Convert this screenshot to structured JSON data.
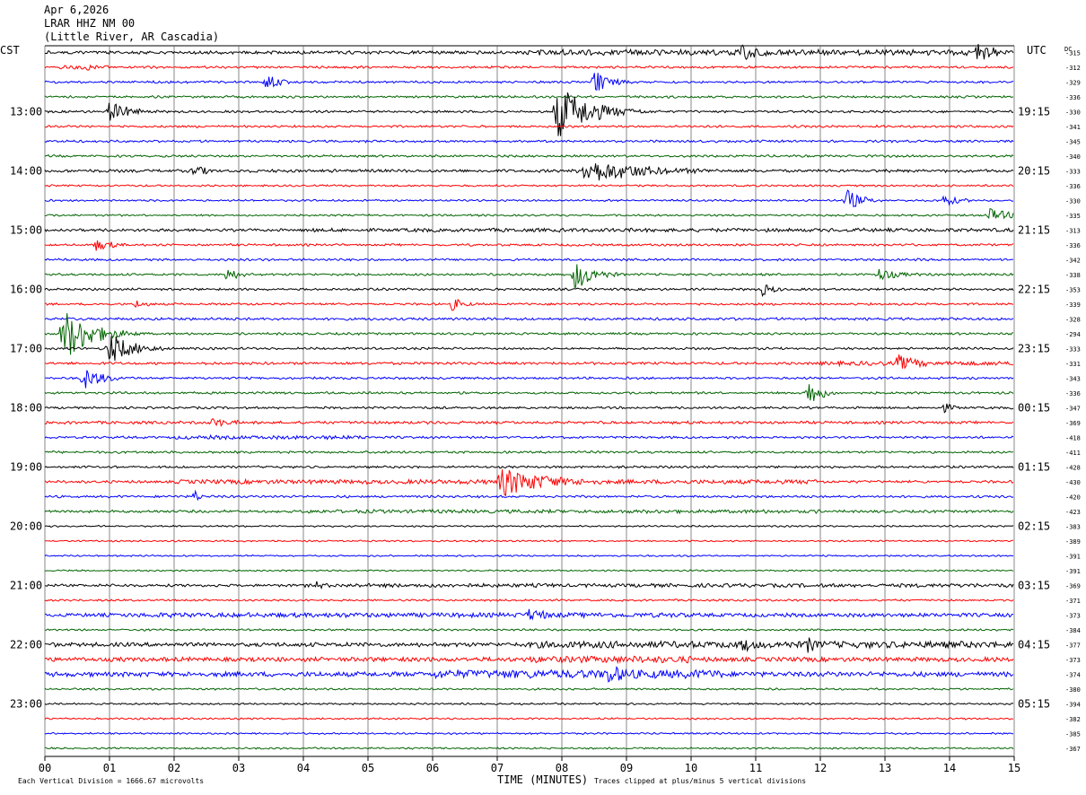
{
  "header": {
    "date": "Apr 6,2026",
    "station": "LRAR HHZ NM 00",
    "location": "(Little River, AR Cascadia)"
  },
  "footer": {
    "x_axis_title": "TIME (MINUTES)",
    "vertical_division": "Each Vertical Division = 1666.67 microvolts",
    "clip_note": "Traces clipped at plus/minus 5 vertical divisions"
  },
  "chart_data": {
    "type": "line",
    "title": "LRAR HHZ NM 00",
    "left_axis_label": "CST",
    "right_axis_label": "UTC",
    "dc_label": "DC",
    "xlabel": "TIME (MINUTES)",
    "xlim": [
      0,
      15
    ],
    "x_ticks": [
      "00",
      "01",
      "02",
      "03",
      "04",
      "05",
      "06",
      "07",
      "08",
      "09",
      "10",
      "11",
      "12",
      "13",
      "14",
      "15"
    ],
    "trace_colors": [
      "#000000",
      "#ff0000",
      "#0000ff",
      "#006400"
    ],
    "cst_hour_labels": [
      "13:00",
      "14:00",
      "15:00",
      "16:00",
      "17:00",
      "18:00",
      "19:00",
      "20:00",
      "21:00",
      "22:00",
      "23:00"
    ],
    "utc_hour_labels": [
      "19:15",
      "20:15",
      "21:15",
      "22:15",
      "23:15",
      "00:15",
      "01:15",
      "02:15",
      "03:15",
      "04:15",
      "05:15"
    ],
    "hour_label_first_row": 4,
    "hour_label_every_rows": 4,
    "dc_offsets": [
      -315,
      -312,
      -329,
      -336,
      -330,
      -341,
      -345,
      -340,
      -333,
      -336,
      -330,
      -335,
      -313,
      -336,
      -342,
      -338,
      -353,
      -339,
      -328,
      -294,
      -333,
      -331,
      -343,
      -336,
      -347,
      -369,
      -418,
      -411,
      -428,
      -430,
      -420,
      -423,
      -383,
      -389,
      -391,
      -391,
      -369,
      -371,
      -373,
      -384,
      -377,
      -373,
      -374,
      -380,
      -394,
      -382,
      -385,
      -367
    ],
    "row_noise_level": [
      1.5,
      1,
      1,
      1,
      1,
      1,
      1,
      1,
      1.4,
      0.8,
      0.8,
      0.8,
      1.3,
      1,
      1,
      1,
      1,
      1,
      1.2,
      1,
      1,
      1.2,
      1,
      1,
      1,
      1.3,
      1,
      1,
      1,
      1.2,
      1,
      1.2,
      0.6,
      0.6,
      0.6,
      0.6,
      1.2,
      0.8,
      1.8,
      0.8,
      2,
      2.2,
      2.4,
      0.8,
      0.7,
      0.7,
      0.7,
      0.7
    ],
    "row_noise_bursts": [
      {
        "row": 0,
        "from": 7.4,
        "to": 15,
        "level": 3
      },
      {
        "row": 1,
        "from": 0.2,
        "to": 1,
        "level": 2
      },
      {
        "row": 12,
        "from": 4,
        "to": 15,
        "level": 1.8
      },
      {
        "row": 26,
        "from": 2,
        "to": 5,
        "level": 1.8
      },
      {
        "row": 29,
        "from": 2,
        "to": 12,
        "level": 2.2
      },
      {
        "row": 31,
        "from": 4,
        "to": 12,
        "level": 1.8
      },
      {
        "row": 36,
        "from": 4,
        "to": 15,
        "level": 1.8
      },
      {
        "row": 38,
        "from": 1.5,
        "to": 10,
        "level": 2.4
      },
      {
        "row": 40,
        "from": 7.5,
        "to": 15,
        "level": 3.5
      },
      {
        "row": 41,
        "from": 7.5,
        "to": 10,
        "level": 3.5
      },
      {
        "row": 42,
        "from": 6,
        "to": 10.5,
        "level": 4.5
      },
      {
        "row": 21,
        "from": 12,
        "to": 15,
        "level": 2.2
      }
    ],
    "events": [
      {
        "row": 0,
        "minute": 10.8,
        "amplitude": 12,
        "duration": 0.4
      },
      {
        "row": 0,
        "minute": 14.4,
        "amplitude": 12,
        "duration": 0.5
      },
      {
        "row": 1,
        "minute": 0.6,
        "amplitude": 6,
        "duration": 0.3
      },
      {
        "row": 2,
        "minute": 3.4,
        "amplitude": 10,
        "duration": 0.3
      },
      {
        "row": 2,
        "minute": 8.5,
        "amplitude": 14,
        "duration": 0.35
      },
      {
        "row": 4,
        "minute": 1.0,
        "amplitude": 12,
        "duration": 0.45
      },
      {
        "row": 4,
        "minute": 7.95,
        "amplitude": 30,
        "duration": 0.7
      },
      {
        "row": 8,
        "minute": 2.3,
        "amplitude": 8,
        "duration": 0.3
      },
      {
        "row": 8,
        "minute": 8.4,
        "amplitude": 14,
        "duration": 1.3
      },
      {
        "row": 10,
        "minute": 12.4,
        "amplitude": 14,
        "duration": 0.3
      },
      {
        "row": 10,
        "minute": 13.9,
        "amplitude": 8,
        "duration": 0.3
      },
      {
        "row": 11,
        "minute": 14.6,
        "amplitude": 8,
        "duration": 0.5
      },
      {
        "row": 13,
        "minute": 0.8,
        "amplitude": 7,
        "duration": 0.4
      },
      {
        "row": 15,
        "minute": 2.8,
        "amplitude": 8,
        "duration": 0.3
      },
      {
        "row": 15,
        "minute": 8.2,
        "amplitude": 18,
        "duration": 0.4
      },
      {
        "row": 15,
        "minute": 12.9,
        "amplitude": 7,
        "duration": 0.5
      },
      {
        "row": 16,
        "minute": 11.1,
        "amplitude": 8,
        "duration": 0.25
      },
      {
        "row": 17,
        "minute": 1.4,
        "amplitude": 5,
        "duration": 0.3
      },
      {
        "row": 17,
        "minute": 6.3,
        "amplitude": 8,
        "duration": 0.25
      },
      {
        "row": 19,
        "minute": 0.3,
        "amplitude": 30,
        "duration": 0.6
      },
      {
        "row": 20,
        "minute": 1.0,
        "amplitude": 18,
        "duration": 0.5
      },
      {
        "row": 21,
        "minute": 13.2,
        "amplitude": 10,
        "duration": 0.5
      },
      {
        "row": 22,
        "minute": 0.6,
        "amplitude": 13,
        "duration": 0.4
      },
      {
        "row": 23,
        "minute": 11.8,
        "amplitude": 16,
        "duration": 0.3
      },
      {
        "row": 24,
        "minute": 13.9,
        "amplitude": 6,
        "duration": 0.3
      },
      {
        "row": 25,
        "minute": 2.6,
        "amplitude": 5,
        "duration": 0.6
      },
      {
        "row": 29,
        "minute": 7.1,
        "amplitude": 16,
        "duration": 1.1
      },
      {
        "row": 30,
        "minute": 2.3,
        "amplitude": 9,
        "duration": 0.15
      },
      {
        "row": 36,
        "minute": 4.2,
        "amplitude": 6,
        "duration": 0.2
      },
      {
        "row": 38,
        "minute": 7.5,
        "amplitude": 8,
        "duration": 0.5
      },
      {
        "row": 40,
        "minute": 10.8,
        "amplitude": 10,
        "duration": 0.3
      },
      {
        "row": 40,
        "minute": 11.8,
        "amplitude": 10,
        "duration": 0.3
      },
      {
        "row": 42,
        "minute": 8.7,
        "amplitude": 12,
        "duration": 0.6
      }
    ]
  }
}
